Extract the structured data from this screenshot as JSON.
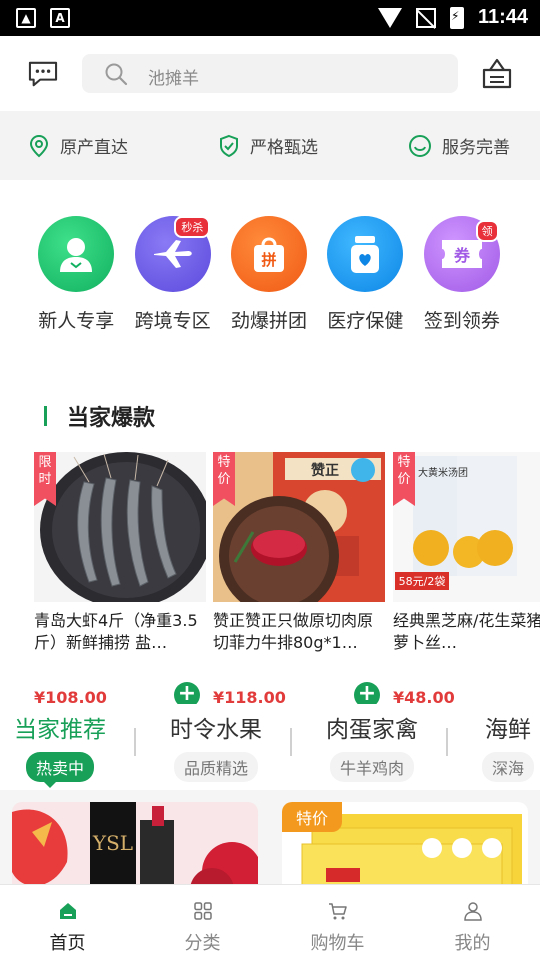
{
  "status_bar": {
    "time": "11:44"
  },
  "search": {
    "placeholder": "池摊羊"
  },
  "features": [
    {
      "icon": "location-pin-icon",
      "label": "原产直达"
    },
    {
      "icon": "shield-check-icon",
      "label": "严格甄选"
    },
    {
      "icon": "smile-icon",
      "label": "服务完善"
    }
  ],
  "quick_entries": [
    {
      "icon": "person-icon",
      "label": "新人专享",
      "color": "#1fc06a"
    },
    {
      "icon": "airplane-icon",
      "label": "跨境专区",
      "color": "#6f5fe6",
      "badge": "秒杀"
    },
    {
      "icon": "shopping-bag-icon",
      "label": "劲爆拼团",
      "color": "#f56a1e",
      "badge_icon": "拼"
    },
    {
      "icon": "medicine-bottle-icon",
      "label": "医疗保健",
      "color": "#1c9cf0"
    },
    {
      "icon": "coupon-icon",
      "label": "签到领券",
      "color": "#b36ef0",
      "badge": "领",
      "icon_text": "券"
    }
  ],
  "hot_section": {
    "title": "当家爆款"
  },
  "products": [
    {
      "tag": "限时",
      "name": "青岛大虾4斤（净重3.5斤）新鲜捕捞  盐…",
      "price": "¥108.00"
    },
    {
      "tag": "特价",
      "name": "赞正赞正只做原切肉原切菲力牛排80g*1…",
      "price": "¥118.00",
      "brand": "赞正"
    },
    {
      "tag": "特价",
      "name": "经典黑芝麻/花生菜猪肉/萝卜丝…",
      "price": "¥48.00",
      "sub_price": "58元/2袋",
      "brand": "大黄米汤团"
    }
  ],
  "category_tabs": [
    {
      "title": "当家推荐",
      "sub": "热卖中",
      "active": true
    },
    {
      "title": "时令水果",
      "sub": "品质精选"
    },
    {
      "title": "肉蛋家禽",
      "sub": "牛羊鸡肉"
    },
    {
      "title": "海鲜",
      "sub": "深海"
    }
  ],
  "grid_cards": [
    {
      "tag": ""
    },
    {
      "tag": "特价"
    }
  ],
  "tabbar": [
    {
      "icon": "home-icon",
      "label": "首页",
      "active": true
    },
    {
      "icon": "category-grid-icon",
      "label": "分类"
    },
    {
      "icon": "cart-icon",
      "label": "购物车"
    },
    {
      "icon": "user-icon",
      "label": "我的"
    }
  ],
  "colors": {
    "accent": "#18a058",
    "price": "#e23b3b",
    "tag": "#f05060"
  }
}
